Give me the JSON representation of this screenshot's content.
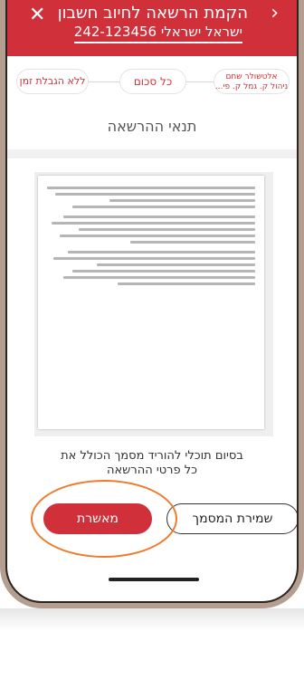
{
  "header": {
    "title": "הקמת הרשאה לחיוב חשבון",
    "subtitle": "ישראל ישראלי 242-123456",
    "close_glyph": "✕",
    "back_glyph": "›",
    "background_color": "#d0303a"
  },
  "stepper": {
    "steps": [
      {
        "label_line1": "אלטשולר שחם",
        "label_line2": "ניהול ק. גמל ק. פי..."
      },
      {
        "label": "כל סכום"
      },
      {
        "label": "ללא הגבלת זמן"
      }
    ]
  },
  "section_title": "תנאי ההרשאה",
  "caption": {
    "line1": "בסיום תוכלי להוריד מסמך הכולל את",
    "line2": "כל פרטי ההרשאה"
  },
  "buttons": {
    "save_label": "שמירת המסמך",
    "approve_label": "מאשרת"
  },
  "colors": {
    "accent": "#d0303a",
    "highlight": "#f07a2a"
  }
}
